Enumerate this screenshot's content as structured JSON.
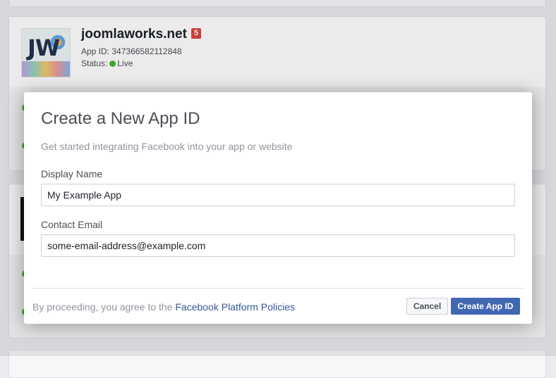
{
  "background_app": {
    "name": "joomlaworks.net",
    "badge": "5",
    "app_id_label": "App ID:",
    "app_id": "347366582112848",
    "status_label": "Status:",
    "status_value": "Live",
    "logo_text": "JW"
  },
  "modal": {
    "title": "Create a New App ID",
    "subtitle": "Get started integrating Facebook into your app or website",
    "display_name_label": "Display Name",
    "display_name_value": "My Example App",
    "contact_email_label": "Contact Email",
    "contact_email_value": "some-email-address@example.com",
    "footer_prefix": "By proceeding, you agree to the",
    "footer_link": "Facebook Platform Policies",
    "cancel_label": "Cancel",
    "create_label": "Create App ID"
  },
  "colors": {
    "primary": "#4267b2",
    "link": "#365899",
    "live": "#42b72a",
    "badge": "#d8453c"
  }
}
